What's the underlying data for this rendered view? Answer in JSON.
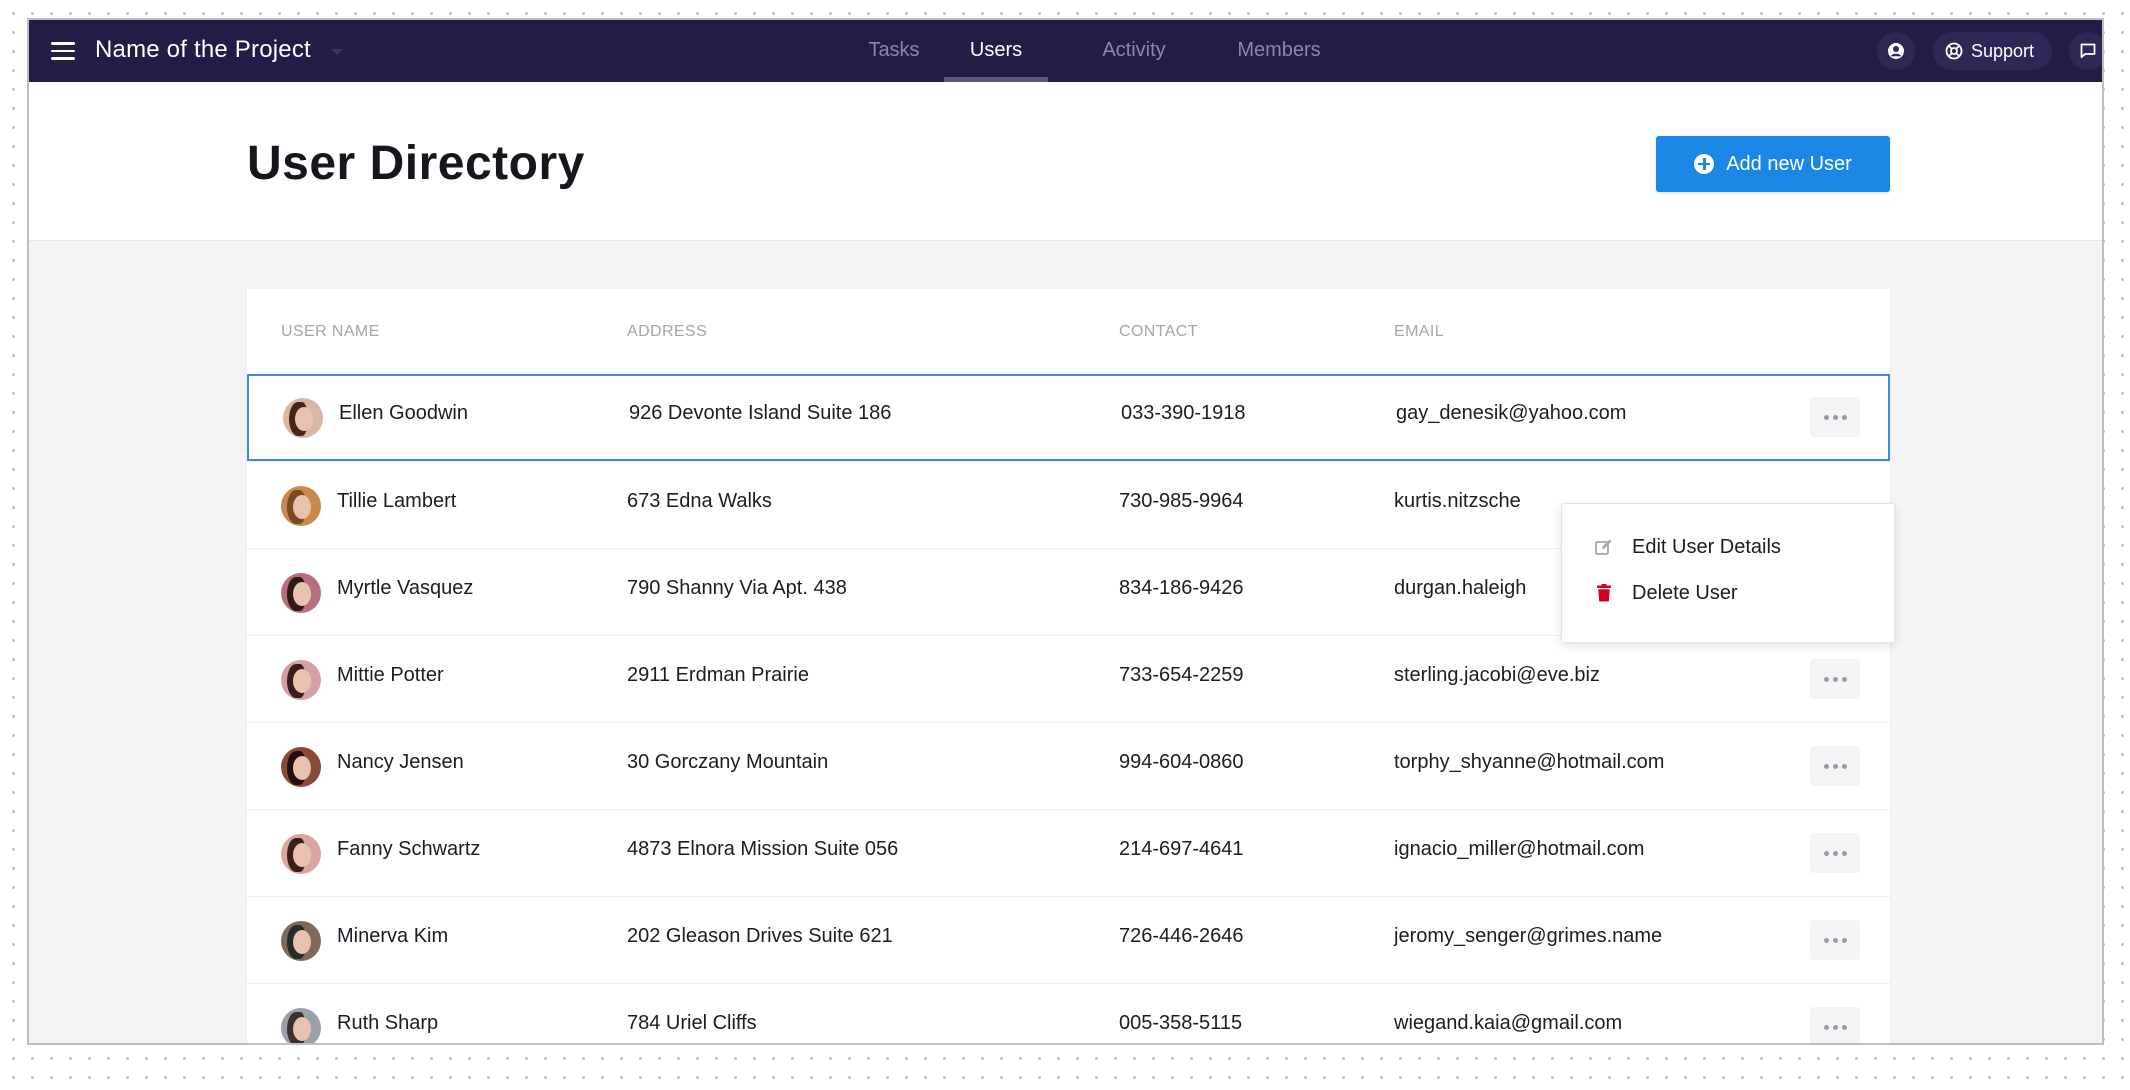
{
  "topbar": {
    "project_title": "Name of the Project",
    "tabs": [
      {
        "label": "Tasks"
      },
      {
        "label": "Users"
      },
      {
        "label": "Activity"
      },
      {
        "label": "Members"
      }
    ],
    "active_tab": "Users",
    "support_label": "Support",
    "icons": [
      "menu-icon",
      "user-icon",
      "globe-icon",
      "chat-icon"
    ]
  },
  "header": {
    "page_title": "User Directory",
    "add_button_label": "Add new User"
  },
  "table": {
    "columns": [
      "USER NAME",
      "ADDRESS",
      "CONTACT",
      "EMAIL"
    ],
    "rows": [
      {
        "name": "Ellen Goodwin",
        "address": "926 Devonte Island Suite 186",
        "contact": "033-390-1918",
        "email": "gay_denesik@yahoo.com"
      },
      {
        "name": "Tillie Lambert",
        "address": "673 Edna Walks",
        "contact": "730-985-9964",
        "email": "kurtis.nitzsche"
      },
      {
        "name": "Myrtle Vasquez",
        "address": "790 Shanny Via Apt. 438",
        "contact": "834-186-9426",
        "email": "durgan.haleigh"
      },
      {
        "name": "Mittie Potter",
        "address": "2911 Erdman Prairie",
        "contact": "733-654-2259",
        "email": "sterling.jacobi@eve.biz"
      },
      {
        "name": "Nancy Jensen",
        "address": "30 Gorczany Mountain",
        "contact": "994-604-0860",
        "email": "torphy_shyanne@hotmail.com"
      },
      {
        "name": "Fanny Schwartz",
        "address": "4873 Elnora Mission Suite 056",
        "contact": "214-697-4641",
        "email": "ignacio_miller@hotmail.com"
      },
      {
        "name": "Minerva Kim",
        "address": "202 Gleason Drives Suite 621",
        "contact": "726-446-2646",
        "email": "jeromy_senger@grimes.name"
      },
      {
        "name": "Ruth Sharp",
        "address": "784 Uriel Cliffs",
        "contact": "005-358-5115",
        "email": "wiegand.kaia@gmail.com"
      }
    ],
    "selected_row": 0
  },
  "context_menu": {
    "items": [
      {
        "label": "Edit User Details",
        "icon": "edit-icon"
      },
      {
        "label": "Delete User",
        "icon": "trash-icon"
      }
    ]
  },
  "colors": {
    "topbar_bg": "#221c47",
    "accent_blue": "#1a86e5",
    "delete_red": "#d0021b",
    "selected_border": "#3d8ae0"
  }
}
